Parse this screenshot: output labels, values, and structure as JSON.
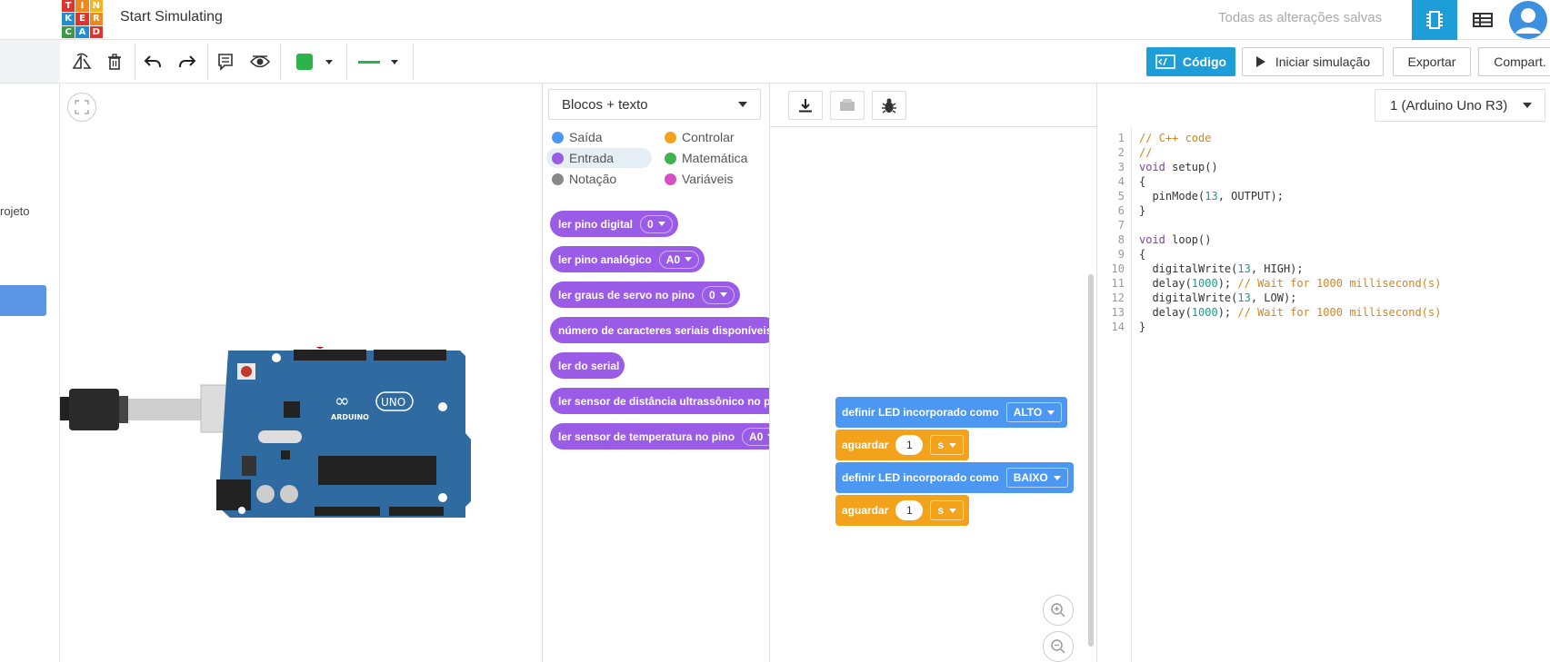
{
  "header": {
    "logo_letters": [
      "T",
      "I",
      "N",
      "K",
      "E",
      "R",
      "C",
      "A",
      "D"
    ],
    "title": "Start Simulating",
    "save_status": "Todas as alterações salvas"
  },
  "sidebar": {
    "project_label": "rojeto"
  },
  "toolbar": {
    "color_swatch": "#2db34a",
    "code_label": "Código",
    "simulate_label": "Iniciar simulação",
    "export_label": "Exportar",
    "share_label": "Compart."
  },
  "blocks": {
    "mode": "Blocos + texto",
    "categories": [
      {
        "label": "Saída",
        "color": "#4c97f2"
      },
      {
        "label": "Controlar",
        "color": "#f3a21b"
      },
      {
        "label": "Entrada",
        "color": "#9a5ce6"
      },
      {
        "label": "Matemática",
        "color": "#3fb34f"
      },
      {
        "label": "Notação",
        "color": "#888888"
      },
      {
        "label": "Variáveis",
        "color": "#d64fc6"
      }
    ],
    "palette": [
      {
        "label": "ler pino digital",
        "value": "0"
      },
      {
        "label": "ler pino analógico",
        "value": "A0"
      },
      {
        "label": "ler graus de servo no pino",
        "value": "0"
      },
      {
        "label": "número de caracteres seriais disponíveis",
        "value": ""
      },
      {
        "label": "ler do serial",
        "value": ""
      },
      {
        "label": "ler sensor de distância ultrassônico no pino",
        "value": ""
      },
      {
        "label": "ler sensor de temperatura no pino",
        "value": "A0"
      }
    ]
  },
  "workspace": {
    "program": [
      {
        "type": "led",
        "label": "definir LED incorporado como",
        "value": "ALTO"
      },
      {
        "type": "wait",
        "label": "aguardar",
        "number": "1",
        "unit": "s"
      },
      {
        "type": "led",
        "label": "definir LED incorporado como",
        "value": "BAIXO"
      },
      {
        "type": "wait",
        "label": "aguardar",
        "number": "1",
        "unit": "s"
      }
    ]
  },
  "code": {
    "board": "1 (Arduino Uno R3)",
    "line_numbers": [
      "1",
      "2",
      "3",
      "4",
      "5",
      "6",
      "7",
      "8",
      "9",
      "10",
      "11",
      "12",
      "13",
      "14"
    ]
  }
}
